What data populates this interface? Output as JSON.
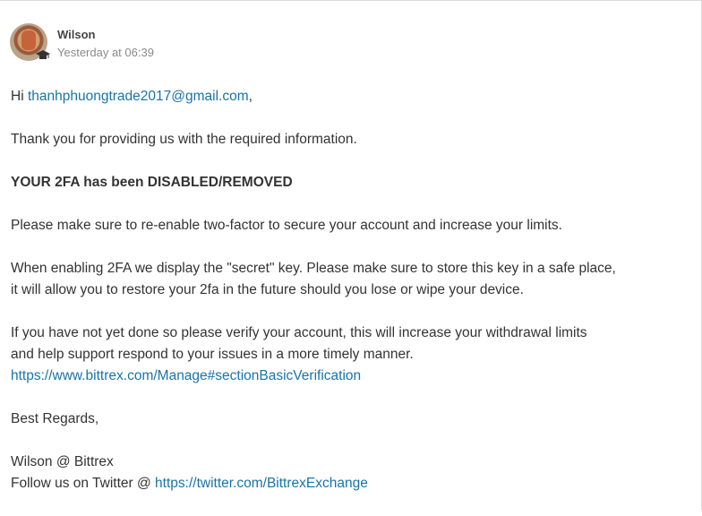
{
  "message": {
    "sender": "Wilson",
    "timestamp": "Yesterday at 06:39",
    "greeting_prefix": "Hi ",
    "greeting_email": "thanhphuongtrade2017@gmail.com",
    "greeting_suffix": ",",
    "para_thanks": "Thank you for providing us with the required information.",
    "para_alert": "YOUR 2FA has been DISABLED/REMOVED",
    "para_reenable": "Please make sure to re-enable two-factor to secure your account and increase your limits.",
    "para_secret_line1": "When enabling 2FA we display the \"secret\" key. Please make sure to store this key in a safe place,",
    "para_secret_line2": "it will allow you to restore your 2fa in the future should you lose or wipe your device.",
    "para_verify_line1": "If you have not yet done so please verify your account, this will increase your withdrawal limits",
    "para_verify_line2": "and help support respond to your issues in a more timely manner.",
    "verify_link": "https://www.bittrex.com/Manage#sectionBasicVerification",
    "closing": "Best Regards,",
    "signature_name": "Wilson @ Bittrex",
    "follow_prefix": "Follow us on Twitter @ ",
    "twitter_link": "https://twitter.com/BittrexExchange"
  },
  "icons": {
    "avatar": "avatar",
    "badge": "graduation-cap-icon"
  }
}
